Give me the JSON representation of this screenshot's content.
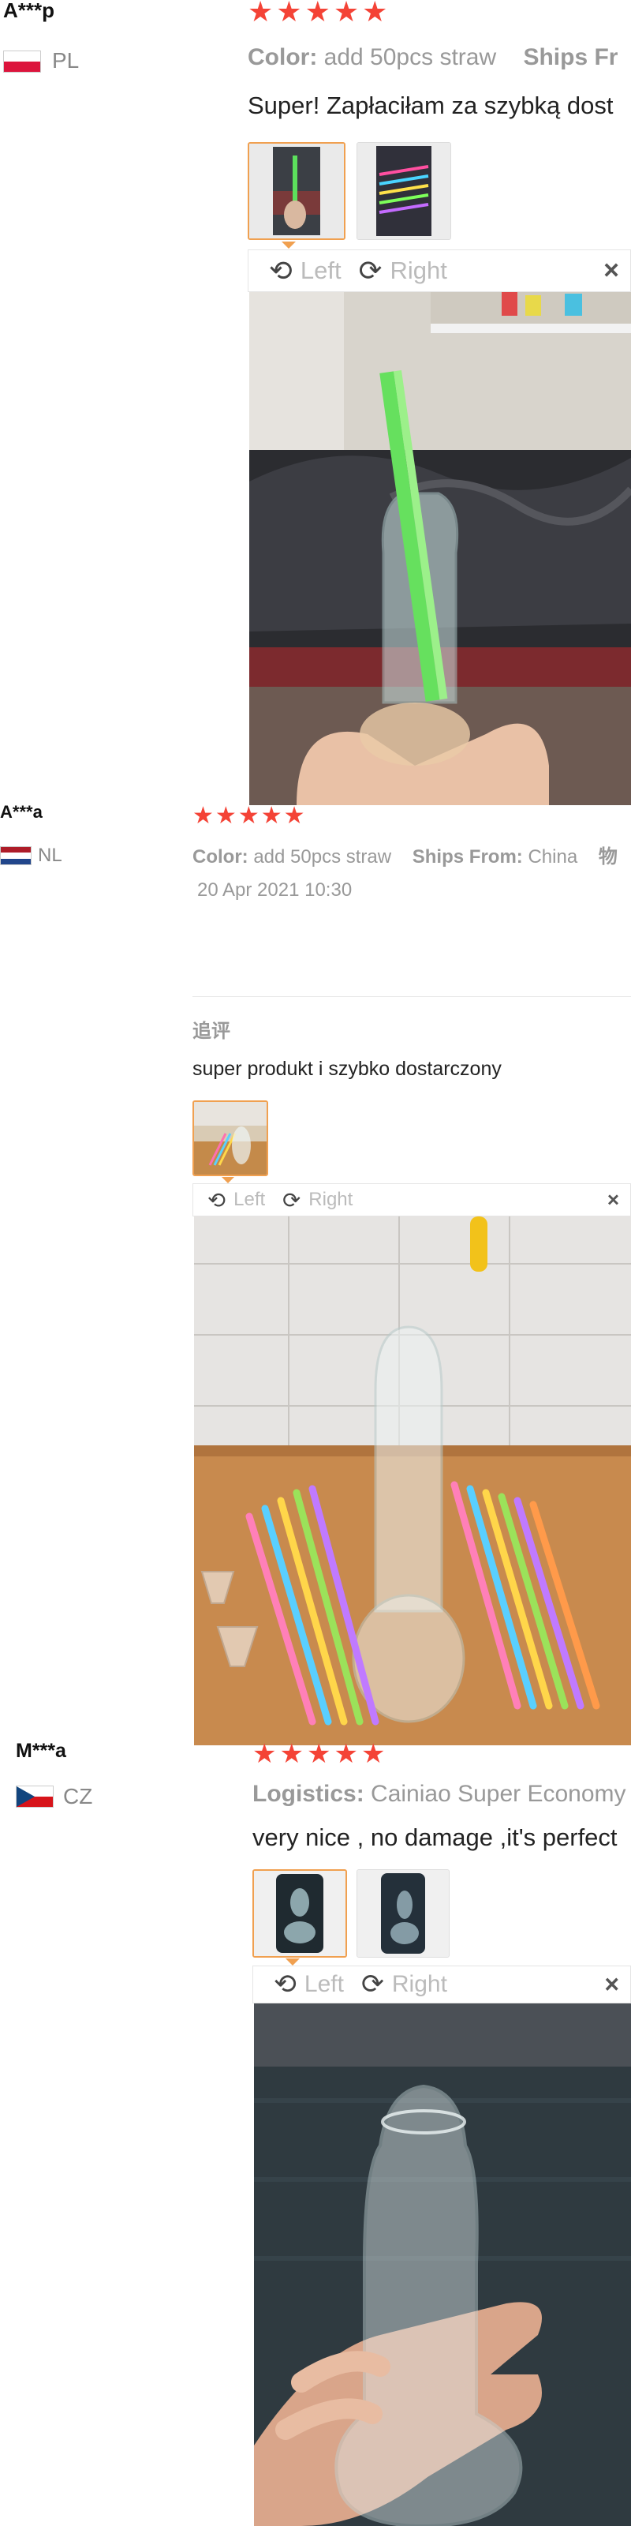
{
  "reviews": [
    {
      "name": "A***p",
      "country": "PL",
      "flag_colors": [
        "#ffffff",
        "#dc143c"
      ],
      "stars": [
        "★",
        "★",
        "★",
        "★",
        "★"
      ],
      "attrs": [
        {
          "label": "Color:",
          "value": "add 50pcs straw"
        },
        {
          "label": "Ships Fr",
          "value": ""
        }
      ],
      "text": "Super! Zapłaciłam za szybką dost",
      "toolbar": {
        "left": "Left",
        "right": "Right",
        "close": "×"
      }
    },
    {
      "name": "A***a",
      "country": "NL",
      "flag_colors": [
        "#ae1c28",
        "#ffffff",
        "#21468b"
      ],
      "stars": [
        "★",
        "★",
        "★",
        "★",
        "★"
      ],
      "attrs": [
        {
          "label": "Color:",
          "value": "add 50pcs straw"
        },
        {
          "label": "Ships From:",
          "value": "China"
        },
        {
          "label": "物",
          "value": ""
        }
      ],
      "date": "20 Apr 2021 10:30",
      "followup_label": "追评",
      "followup_text": "super produkt i szybko dostarczony",
      "toolbar": {
        "left": "Left",
        "right": "Right",
        "close": "×"
      }
    },
    {
      "name": "M***a",
      "country": "CZ",
      "flag_colors": [
        "#ffffff",
        "#d7141a",
        "#11457e"
      ],
      "stars": [
        "★",
        "★",
        "★",
        "★",
        "★"
      ],
      "attrs": [
        {
          "label": "Logistics:",
          "value": "Cainiao Super Economy"
        }
      ],
      "text": "very nice , no damage ,it's perfect",
      "toolbar": {
        "left": "Left",
        "right": "Right",
        "close": "×"
      }
    }
  ],
  "icons": {
    "rotate_left": "⟲",
    "rotate_right": "⟳",
    "star_color": "#f44336",
    "accent": "#f0a050"
  }
}
